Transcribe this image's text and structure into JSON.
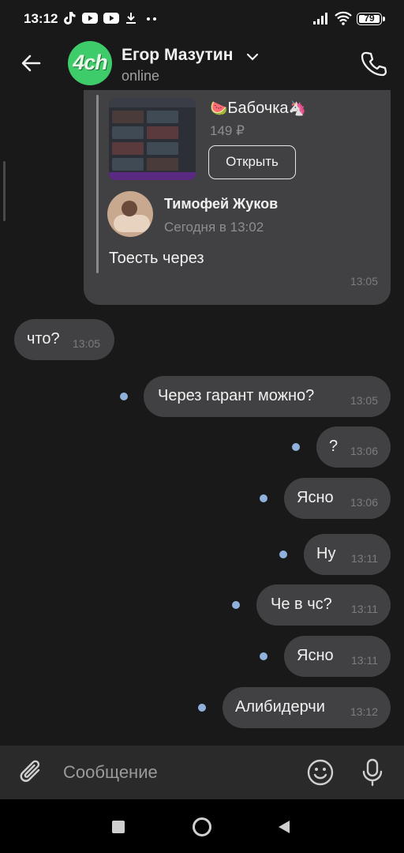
{
  "statusbar": {
    "time": "13:12",
    "battery": "79"
  },
  "header": {
    "avatar_text": "4ch",
    "contact_name": "Егор Мазутин",
    "status": "online"
  },
  "forward": {
    "product_title": "Бабочка",
    "product_emoji_left": "🍉",
    "product_emoji_right": "🦄",
    "price": "149 ₽",
    "open_label": "Открыть",
    "author_name": "Тимофей Жуков",
    "author_time": "Сегодня в 13:02",
    "text": "Тоесть через",
    "time": "13:05"
  },
  "messages": [
    {
      "text": "что?",
      "time": "13:05",
      "side": "in"
    },
    {
      "text": "Через гарант можно?",
      "time": "13:05",
      "side": "out"
    },
    {
      "text": "?",
      "time": "13:06",
      "side": "out"
    },
    {
      "text": "Ясно",
      "time": "13:06",
      "side": "out"
    },
    {
      "text": "Ну",
      "time": "13:11",
      "side": "out"
    },
    {
      "text": "Че в чс?",
      "time": "13:11",
      "side": "out"
    },
    {
      "text": "Ясно",
      "time": "13:11",
      "side": "out"
    },
    {
      "text": "Алибидерчи",
      "time": "13:12",
      "side": "out"
    }
  ],
  "input": {
    "placeholder": "Сообщение"
  },
  "colors": {
    "background": "#19191a",
    "bubble": "#414143",
    "unread_dot": "#8fb2dd",
    "avatar": "#3ecb6a"
  },
  "icons": [
    "back-arrow-icon",
    "chevron-down-icon",
    "phone-icon",
    "paperclip-icon",
    "smile-icon",
    "microphone-icon",
    "tiktok-icon",
    "youtube-icon",
    "download-icon",
    "signal-icon",
    "wifi-icon",
    "battery-icon"
  ]
}
